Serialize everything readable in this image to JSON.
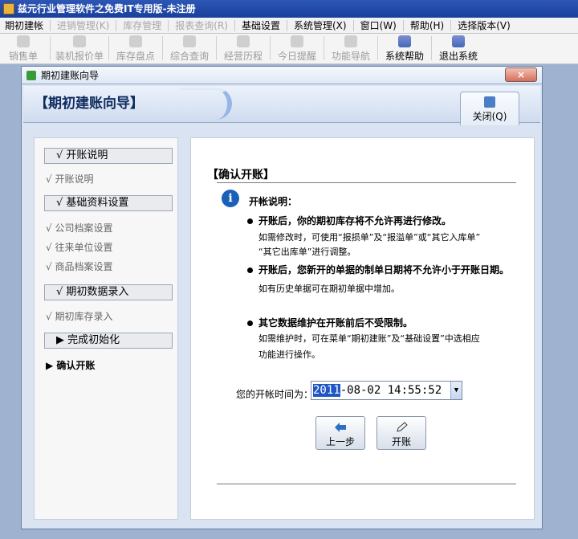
{
  "app": {
    "title": "兹元行业管理软件之免费IT专用版-未注册"
  },
  "menubar": {
    "items": [
      {
        "label": "期初建帐",
        "enabled": true
      },
      {
        "label": "进销管理(K)",
        "enabled": false
      },
      {
        "label": "库存管理",
        "enabled": false
      },
      {
        "label": "报表查询(R)",
        "enabled": false
      },
      {
        "label": "基础设置",
        "enabled": true
      },
      {
        "label": "系统管理(X)",
        "enabled": true
      },
      {
        "label": "窗口(W)",
        "enabled": true
      },
      {
        "label": "帮助(H)",
        "enabled": true
      },
      {
        "label": "选择版本(V)",
        "enabled": true
      }
    ]
  },
  "toolbar": {
    "items": [
      {
        "label": "销售单",
        "icon": "sales-icon",
        "enabled": false
      },
      {
        "label": "装机报价单",
        "icon": "quote-icon",
        "enabled": false
      },
      {
        "label": "库存盘点",
        "icon": "inventory-icon",
        "enabled": false
      },
      {
        "label": "综合查询",
        "icon": "query-icon",
        "enabled": false
      },
      {
        "label": "经营历程",
        "icon": "history-icon",
        "enabled": false
      },
      {
        "label": "今日提醒",
        "icon": "reminder-icon",
        "enabled": false
      },
      {
        "label": "功能导航",
        "icon": "nav-icon",
        "enabled": false
      },
      {
        "label": "系统帮助",
        "icon": "help-icon",
        "enabled": true
      },
      {
        "label": "退出系统",
        "icon": "exit-icon",
        "enabled": true
      }
    ]
  },
  "window": {
    "title": "期初建账向导",
    "close_glyph": "×",
    "banner_title": "【期初建账向导】",
    "close_tab_label": "关闭(Q)"
  },
  "steps": {
    "s1": "√  开账说明",
    "s1_sub": "√  开账说明",
    "s2": "√  基础资料设置",
    "s2_sub1": "√  公司档案设置",
    "s2_sub2": "√  往来单位设置",
    "s2_sub3": "√  商品档案设置",
    "s3": "√  期初数据录入",
    "s3_sub": "√  期初库存录入",
    "s4": "▶  完成初始化",
    "s4_sub": "▶  确认开账"
  },
  "confirm": {
    "title": "【确认开账】",
    "info_head": "开帐说明：",
    "b1_title": "开账后，你的期初库存将不允许再进行修改。",
    "b1_line1": "如需修改时，可使用“报损单”及“报溢单”或“其它入库单”",
    "b1_line2": "“其它出库单”进行调整。",
    "b2_title": "开账后，您新开的单据的制单日期将不允许小于开账日期。",
    "b2_line1": "如有历史单据可在期初单据中增加。",
    "b3_title": "其它数据维护在开账前后不受限制。",
    "b3_line1": "如需维护时，可在菜单“期初建账”及“基础设置”中选相应",
    "b3_line2": "功能进行操作。",
    "date_label": "您的开帐时间为：",
    "date_year": "2011",
    "date_rest": "-08-02 14:55:52",
    "prev_label": "上一步",
    "open_label": "开账"
  }
}
